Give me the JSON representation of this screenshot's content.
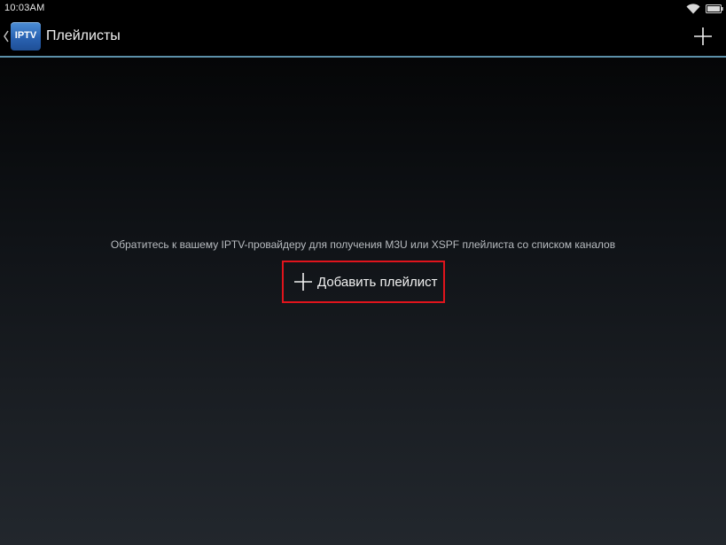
{
  "status_bar": {
    "time": "10:03AM",
    "wifi_icon": "wifi-icon",
    "battery_icon": "battery-icon"
  },
  "action_bar": {
    "back_icon": "chevron-left-icon",
    "app_icon_text": "IPTV",
    "title": "Плейлисты",
    "add_icon": "plus-icon"
  },
  "content": {
    "hint": "Обратитесь к вашему IPTV-провайдеру для получения M3U или XSPF плейлиста со списком каналов",
    "add_playlist_label": "Добавить плейлист",
    "add_playlist_icon": "plus-icon"
  },
  "colors": {
    "accent_line": "#5b8fa8",
    "highlight_border": "#e0141c",
    "app_icon": "#2a63b3"
  }
}
